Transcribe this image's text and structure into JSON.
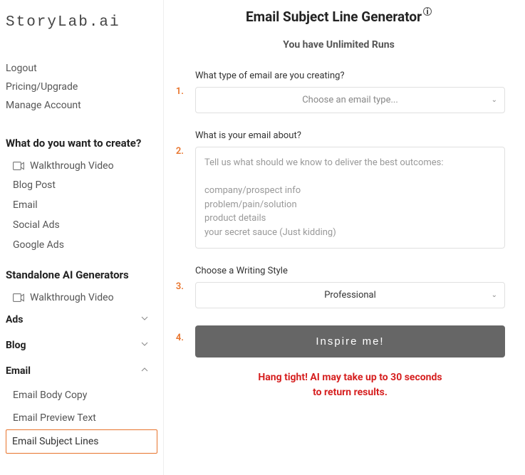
{
  "logo": "StoryLab.ai",
  "nav": {
    "logout": "Logout",
    "pricing": "Pricing/Upgrade",
    "manage": "Manage Account"
  },
  "section1": {
    "heading": "What do you want to create?",
    "walkthrough": "Walkthrough Video",
    "items": [
      "Blog Post",
      "Email",
      "Social Ads",
      "Google Ads"
    ]
  },
  "section2": {
    "heading": "Standalone AI Generators",
    "walkthrough": "Walkthrough Video"
  },
  "accordion": {
    "ads": "Ads",
    "blog": "Blog",
    "email": "Email",
    "email_items": {
      "body": "Email Body Copy",
      "preview": "Email Preview Text",
      "subject": "Email Subject Lines"
    }
  },
  "page": {
    "title": "Email Subject Line Generator",
    "info": "i",
    "subtitle": "You have Unlimited Runs"
  },
  "steps": {
    "s1": "1.",
    "s2": "2.",
    "s3": "3.",
    "s4": "4."
  },
  "form": {
    "q1_label": "What type of email are you creating?",
    "q1_placeholder": "Choose an email type...",
    "q2_label": "What is your email about?",
    "q2_placeholder": "Tell us what should we know to deliver the best outcomes:\n\ncompany/prospect info\nproblem/pain/solution\nproduct details\nyour secret sauce (Just kidding)",
    "q3_label": "Choose a Writing Style",
    "q3_value": "Professional",
    "button": "Inspire me!",
    "wait_line1": "Hang tight! AI may take up to 30 seconds",
    "wait_line2": "to return results."
  }
}
